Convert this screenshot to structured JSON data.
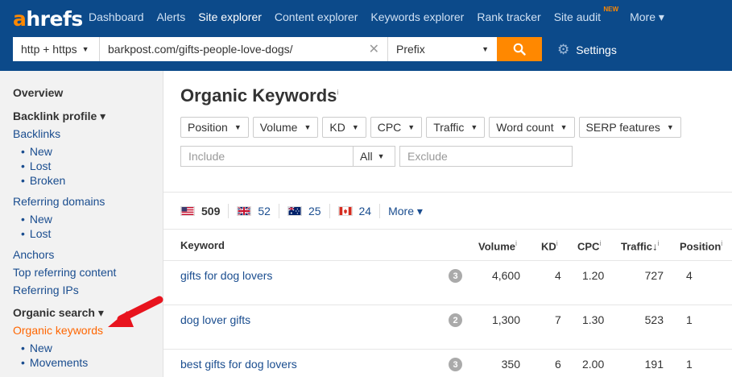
{
  "logo": {
    "a": "a",
    "rest": "hrefs"
  },
  "nav": {
    "items": [
      "Dashboard",
      "Alerts",
      "Site explorer",
      "Content explorer",
      "Keywords explorer",
      "Rank tracker",
      "Site audit"
    ],
    "badge": "NEW",
    "more": "More ▾"
  },
  "search": {
    "protocol": "http + https",
    "url": "barkpost.com/gifts-people-love-dogs/",
    "mode": "Prefix",
    "settings": "Settings"
  },
  "sidebar": {
    "overview": "Overview",
    "backlink_profile": "Backlink profile ▾",
    "backlinks": "Backlinks",
    "bl_new": "New",
    "bl_lost": "Lost",
    "bl_broken": "Broken",
    "referring_domains": "Referring domains",
    "rd_new": "New",
    "rd_lost": "Lost",
    "anchors": "Anchors",
    "top_referring": "Top referring content",
    "referring_ips": "Referring IPs",
    "organic_search": "Organic search ▾",
    "organic_keywords": "Organic keywords",
    "ok_new": "New",
    "ok_movements": "Movements"
  },
  "main": {
    "title": "Organic Keywords",
    "title_info": "i",
    "filters": [
      "Position",
      "Volume",
      "KD",
      "CPC",
      "Traffic",
      "Word count",
      "SERP features"
    ],
    "include_placeholder": "Include",
    "all": "All",
    "exclude_placeholder": "Exclude",
    "countries": [
      {
        "code": "us",
        "count": "509"
      },
      {
        "code": "gb",
        "count": "52"
      },
      {
        "code": "au",
        "count": "25"
      },
      {
        "code": "ca",
        "count": "24"
      }
    ],
    "more": "More ▾"
  },
  "table": {
    "columns": {
      "keyword": "Keyword",
      "volume": "Volume",
      "kd": "KD",
      "cpc": "CPC",
      "traffic": "Traffic",
      "position": "Position",
      "info": "i",
      "sort": "↓"
    },
    "rows": [
      {
        "keyword": "gifts for dog lovers",
        "serp": "3",
        "volume": "4,600",
        "kd": "4",
        "cpc": "1.20",
        "traffic": "727",
        "position": "4"
      },
      {
        "keyword": "dog lover gifts",
        "serp": "2",
        "volume": "1,300",
        "kd": "7",
        "cpc": "1.30",
        "traffic": "523",
        "position": "1"
      },
      {
        "keyword": "best gifts for dog lovers",
        "serp": "3",
        "volume": "350",
        "kd": "6",
        "cpc": "2.00",
        "traffic": "191",
        "position": "1"
      }
    ]
  },
  "colors": {
    "nav_bg": "#0c4a8a",
    "accent": "#ff8800",
    "link": "#1a4d8f",
    "arrow": "#e8141e"
  }
}
